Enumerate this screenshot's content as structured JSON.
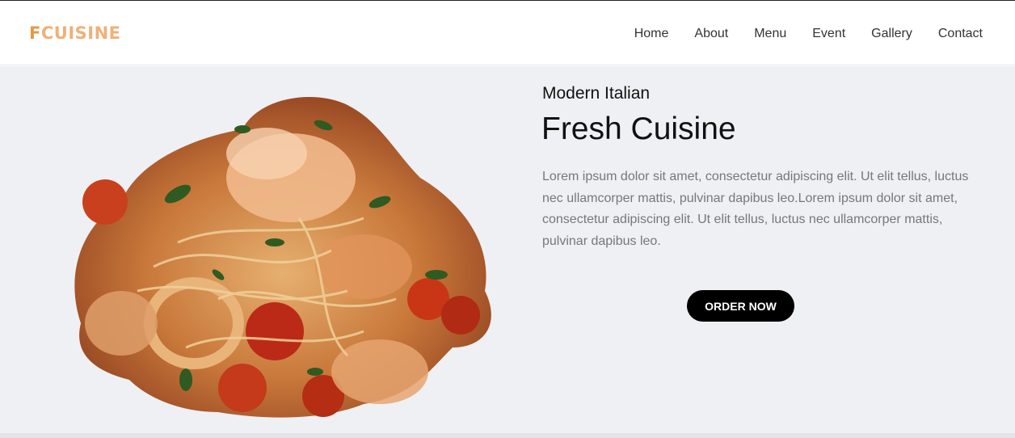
{
  "brand": {
    "logo_first": "F",
    "logo_rest": "CUISINE",
    "color_primary": "#e09a45",
    "color_secondary": "#efb077"
  },
  "nav": {
    "items": [
      {
        "label": "Home"
      },
      {
        "label": "About"
      },
      {
        "label": "Menu"
      },
      {
        "label": "Event"
      },
      {
        "label": "Gallery"
      },
      {
        "label": "Contact"
      }
    ]
  },
  "hero": {
    "subtitle": "Modern Italian",
    "title": "Fresh Cuisine",
    "description": "Lorem ipsum dolor sit amet, consectetur adipiscing elit. Ut elit tellus, luctus nec ullamcorper mattis, pulvinar dapibus leo.Lorem ipsum dolor sit amet, consectetur adipiscing elit. Ut elit tellus, luctus nec ullamcorper mattis, pulvinar dapibus leo.",
    "cta_label": "ORDER NOW",
    "image": "pasta-dish-image",
    "background": "#eff0f4"
  }
}
